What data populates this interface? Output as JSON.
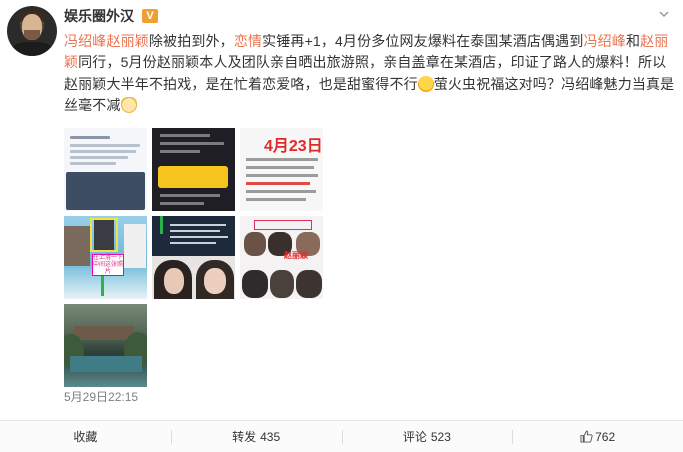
{
  "author": {
    "name": "娱乐圈外汉",
    "badge": "V"
  },
  "post": {
    "segments": [
      {
        "text": "冯绍峰赵丽颖",
        "hl": true
      },
      {
        "text": "除被拍到外，",
        "hl": false
      },
      {
        "text": "恋情",
        "hl": true
      },
      {
        "text": "实锤再+1，4月份多位网友爆料在泰国某酒店偶遇到",
        "hl": false
      },
      {
        "text": "冯绍峰",
        "hl": true
      },
      {
        "text": "和",
        "hl": false
      },
      {
        "text": "赵丽颖",
        "hl": true
      },
      {
        "text": "同行，5月份赵丽颖本人及团队亲自晒出旅游照，亲自盖章在某酒店，印证了路人的爆料！所以赵丽颖大半年不拍戏，是在忙着恋爱咯，也是甜蜜得不行",
        "hl": false
      },
      {
        "text": "萤火虫祝福这对吗？冯绍峰魅力当真是丝毫不减",
        "hl": false
      }
    ],
    "emoji_1": "laugh-emoji",
    "emoji_2": "cat-emoji",
    "timestamp": "5月29日22:15"
  },
  "images": {
    "tile3_date": "4月23日",
    "tile4_tag": "往上滑一下中间这张照片",
    "tile6_tag": "赵丽颖"
  },
  "footer": {
    "collect_label": "收藏",
    "repost_label": "转发",
    "repost_count": "435",
    "comment_label": "评论",
    "comment_count": "523",
    "like_count": "762"
  }
}
